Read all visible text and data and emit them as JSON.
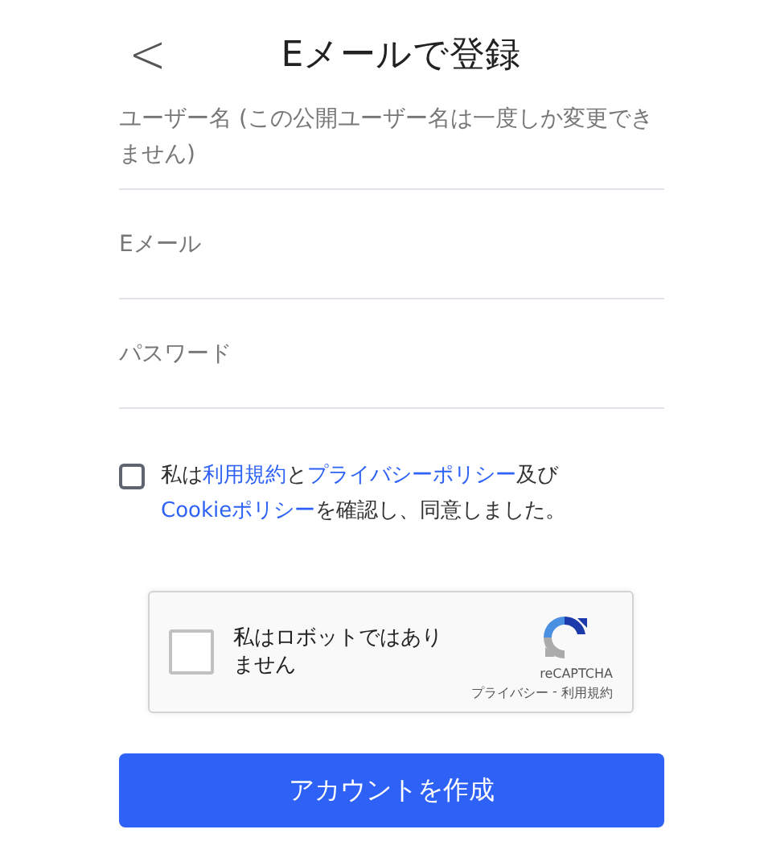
{
  "header": {
    "back": "<",
    "title": "Eメールで登録"
  },
  "fields": [
    {
      "kind": "multiline",
      "placeholder": "ユーザー名 (この公開ユーザー名は一度しか変更できません)"
    },
    {
      "kind": "text",
      "placeholder": "Eメール"
    },
    {
      "kind": "password",
      "placeholder": "パスワード"
    }
  ],
  "consent": {
    "checked": false,
    "segments": [
      {
        "text": "私は",
        "link": false
      },
      {
        "text": "利用規約",
        "link": true
      },
      {
        "text": "と",
        "link": false
      },
      {
        "text": "プライバシーポリシー",
        "link": true
      },
      {
        "text": "及び",
        "link": false
      },
      {
        "text": "Cookieポリシー",
        "link": true
      },
      {
        "text": "を確認し、同意しました。",
        "link": false
      }
    ]
  },
  "captcha": {
    "checked": false,
    "label": "私はロボットではありません",
    "brand": "reCAPTCHA",
    "privacy": "プライバシー",
    "separator": " - ",
    "terms": "利用規約"
  },
  "submit": "アカウントを作成"
}
